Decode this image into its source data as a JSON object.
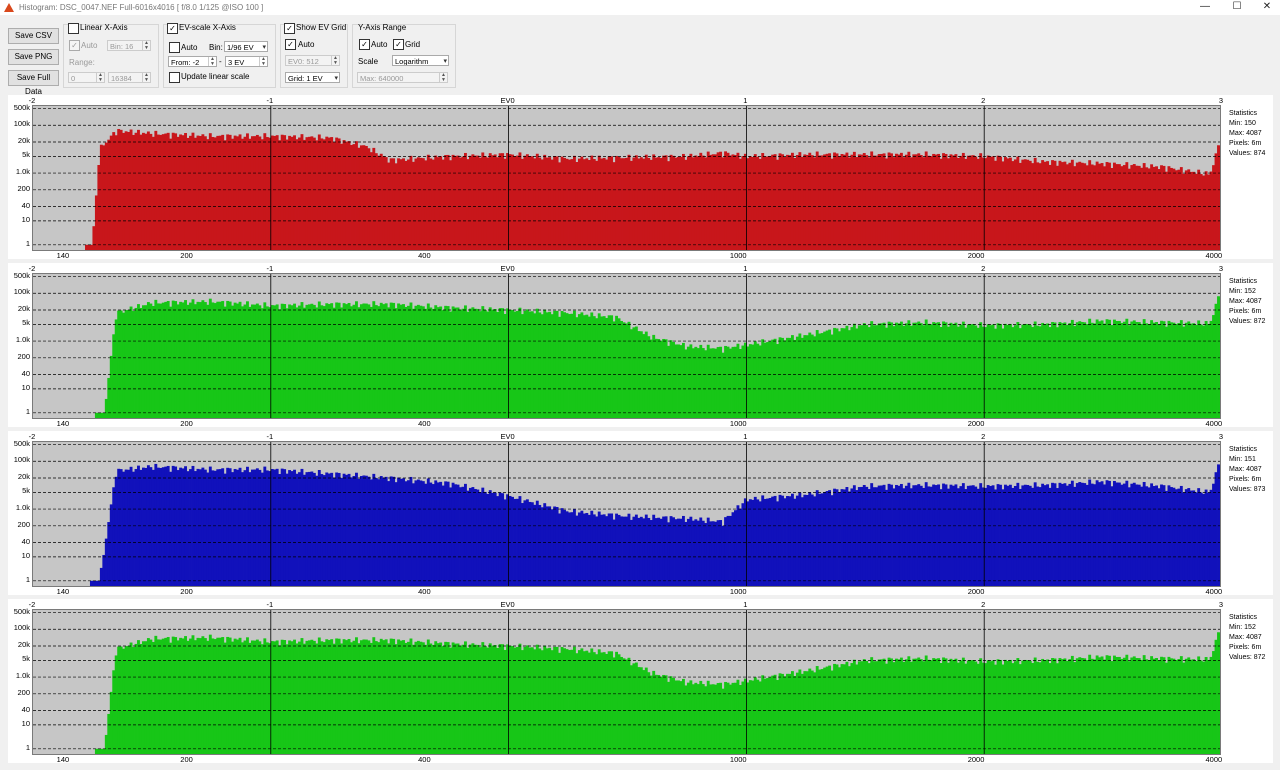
{
  "window": {
    "title": "Histogram: DSC_0047.NEF Full-6016x4016 [ f/8.0 1/125 @ISO 100 ]",
    "minimize": "—",
    "maximize": "☐",
    "close": "✕"
  },
  "toolbar": {
    "save_csv": "Save CSV",
    "save_png": "Save PNG",
    "save_full": "Save Full Data",
    "linear": {
      "label": "Linear X-Axis",
      "checked": false,
      "auto_label": "Auto",
      "auto_checked": true,
      "bin_label": "Bin: 16",
      "range_label": "Range:",
      "range_from": "0",
      "range_to": "16384"
    },
    "ev": {
      "label": "EV-scale X-Axis",
      "checked": true,
      "auto_label": "Auto",
      "auto_checked": false,
      "bin_label": "Bin:",
      "bin_value": "1/96 EV",
      "from_label": "From: -2",
      "dash": "-",
      "to_value": "3 EV",
      "update_label": "Update linear scale",
      "update_checked": false
    },
    "grid": {
      "label": "Show EV Grid",
      "checked": true,
      "auto_label": "Auto",
      "auto_checked": true,
      "ev0": "EV0: 512",
      "grid_value": "Grid: 1 EV"
    },
    "yrange": {
      "label": "Y-Axis Range",
      "auto_label": "Auto",
      "auto_checked": true,
      "grid_label": "Grid",
      "grid_checked": true,
      "scale_label": "Scale",
      "scale_value": "Logarithm",
      "max_value": "Max: 640000"
    }
  },
  "axes": {
    "y_ticks": [
      "500k",
      "100k",
      "20k",
      "5k",
      "1.0k",
      "200",
      "40",
      "10",
      "1"
    ],
    "ev_ticks": [
      "-2",
      "-1",
      "EV0",
      "1",
      "2",
      "3"
    ],
    "linear_ticks": [
      "140",
      "200",
      "400",
      "1000",
      "2000",
      "4000"
    ]
  },
  "panels": [
    {
      "name": "red-channel",
      "color": "#c8161b",
      "stats": {
        "title": "Statistics",
        "min": "Min: 150",
        "max": "Max: 4087",
        "pixels": "Pixels: 6m",
        "values": "Values: 874"
      }
    },
    {
      "name": "green-channel",
      "color": "#17c617",
      "stats": {
        "title": "Statistics",
        "min": "Min: 152",
        "max": "Max: 4087",
        "pixels": "Pixels: 6m",
        "values": "Values: 872"
      }
    },
    {
      "name": "blue-channel",
      "color": "#1111bb",
      "stats": {
        "title": "Statistics",
        "min": "Min: 151",
        "max": "Max: 4087",
        "pixels": "Pixels: 6m",
        "values": "Values: 873"
      }
    },
    {
      "name": "luminance-channel",
      "color": "#17c617",
      "stats": {
        "title": "Statistics",
        "min": "Min: 152",
        "max": "Max: 4087",
        "pixels": "Pixels: 6m",
        "values": "Values: 872"
      }
    }
  ],
  "chart_data": [
    {
      "type": "bar",
      "channel": "red",
      "x_unit": "EV",
      "xlim": [
        -2,
        3
      ],
      "y_scale": "log",
      "ylim": [
        0.5,
        640000
      ],
      "grid": true,
      "x": [
        -1.78,
        -1.75,
        -1.72,
        -1.65,
        -1.5,
        -1.25,
        -1,
        -0.75,
        -0.6,
        -0.5,
        -0.25,
        0,
        0.25,
        0.5,
        0.75,
        0.9,
        1,
        1.25,
        1.5,
        1.75,
        2,
        2.25,
        2.5,
        2.75,
        2.95,
        2.99
      ],
      "values": [
        0,
        1,
        10000,
        60000,
        45000,
        35000,
        35000,
        30000,
        13000,
        3500,
        5000,
        6000,
        4000,
        4500,
        5000,
        7000,
        5000,
        6000,
        6000,
        6000,
        5000,
        3000,
        2500,
        1800,
        900,
        20000
      ]
    },
    {
      "type": "bar",
      "channel": "green",
      "x_unit": "EV",
      "xlim": [
        -2,
        3
      ],
      "y_scale": "log",
      "ylim": [
        0.5,
        640000
      ],
      "grid": true,
      "x": [
        -1.74,
        -1.7,
        -1.65,
        -1.5,
        -1.25,
        -1,
        -0.75,
        -0.5,
        -0.25,
        0,
        0.25,
        0.45,
        0.6,
        0.75,
        0.9,
        1,
        1.25,
        1.5,
        1.75,
        2,
        2.25,
        2.5,
        2.75,
        2.95,
        2.99
      ],
      "values": [
        0,
        1,
        15000,
        40000,
        45000,
        30000,
        35000,
        35000,
        25000,
        20000,
        15000,
        10000,
        1500,
        600,
        500,
        700,
        1800,
        5000,
        6000,
        4500,
        5000,
        7000,
        6000,
        5500,
        100000
      ]
    },
    {
      "type": "bar",
      "channel": "blue",
      "x_unit": "EV",
      "xlim": [
        -2,
        3
      ],
      "y_scale": "log",
      "ylim": [
        0.5,
        640000
      ],
      "grid": true,
      "x": [
        -1.76,
        -1.72,
        -1.65,
        -1.5,
        -1.25,
        -1,
        -0.75,
        -0.5,
        -0.25,
        0,
        0.25,
        0.5,
        0.75,
        0.9,
        1,
        1.25,
        1.5,
        1.75,
        2,
        2.25,
        2.5,
        2.75,
        2.95,
        2.99
      ],
      "values": [
        0,
        1,
        40000,
        60000,
        45000,
        45000,
        30000,
        20000,
        12000,
        3500,
        800,
        500,
        400,
        300,
        2500,
        4000,
        9000,
        10000,
        9000,
        10000,
        14000,
        9000,
        5000,
        100000
      ]
    },
    {
      "type": "bar",
      "channel": "luminance",
      "x_unit": "EV",
      "xlim": [
        -2,
        3
      ],
      "y_scale": "log",
      "ylim": [
        0.5,
        640000
      ],
      "grid": true,
      "x": [
        -1.74,
        -1.7,
        -1.65,
        -1.5,
        -1.25,
        -1,
        -0.75,
        -0.5,
        -0.25,
        0,
        0.25,
        0.45,
        0.6,
        0.75,
        0.9,
        1,
        1.25,
        1.5,
        1.75,
        2,
        2.25,
        2.5,
        2.75,
        2.95,
        2.99
      ],
      "values": [
        0,
        1,
        15000,
        40000,
        45000,
        30000,
        35000,
        35000,
        25000,
        20000,
        15000,
        10000,
        1500,
        600,
        500,
        700,
        1800,
        5000,
        6000,
        4500,
        5000,
        7000,
        6000,
        5500,
        100000
      ]
    }
  ]
}
